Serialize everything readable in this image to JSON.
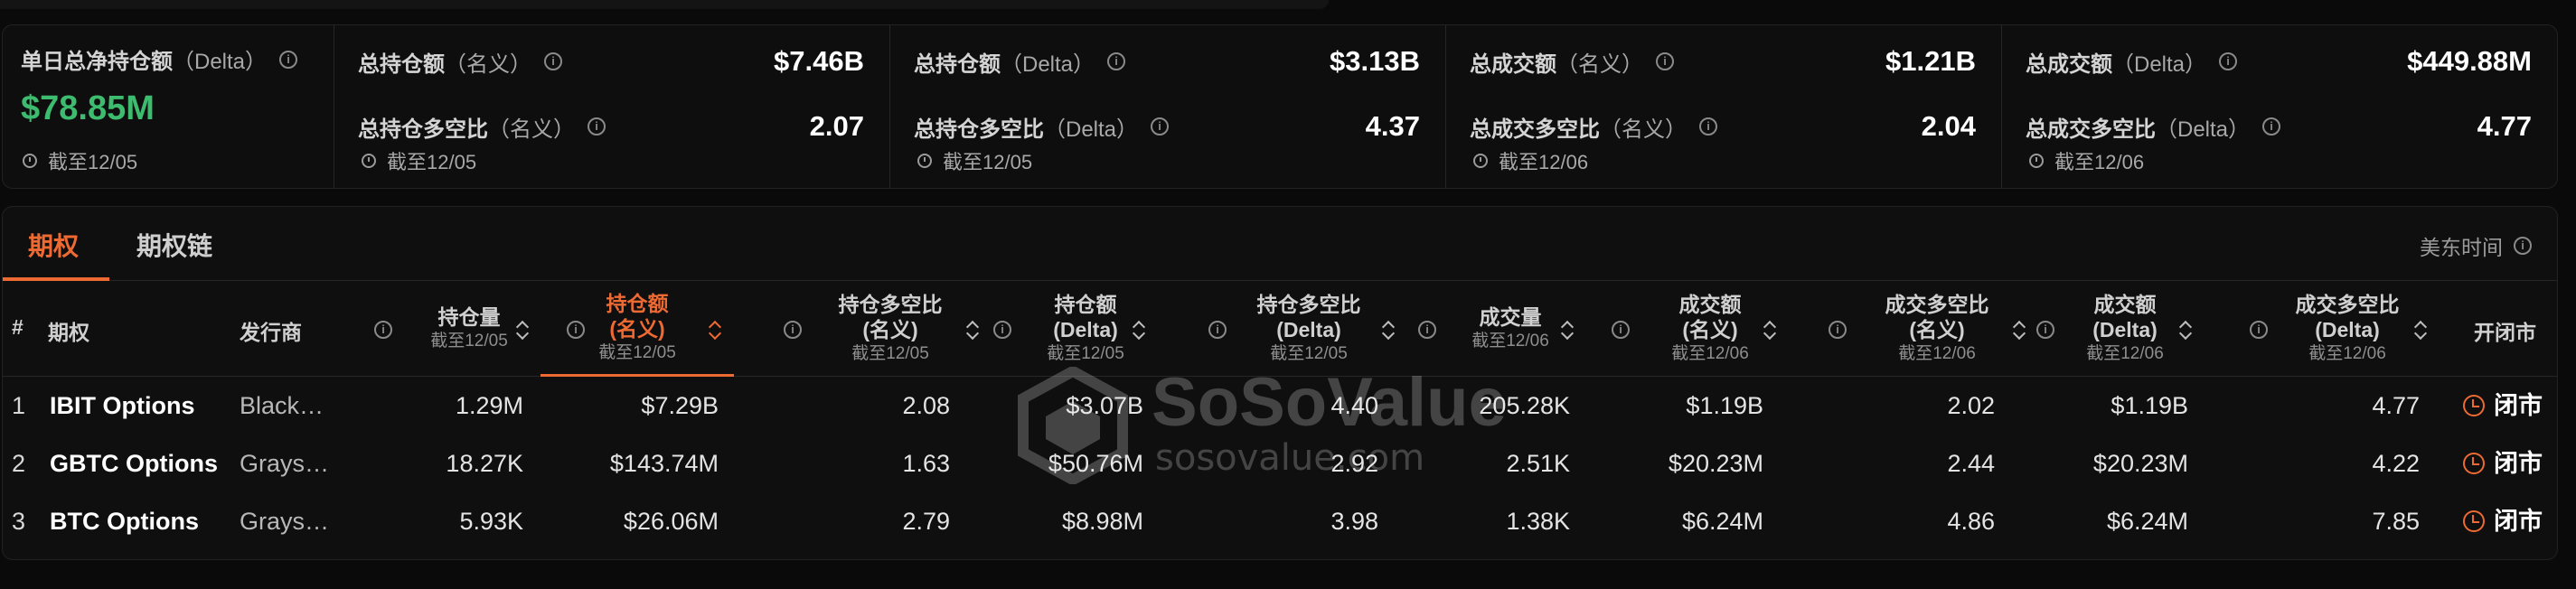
{
  "stats": {
    "daily": {
      "label": "单日总净持仓额",
      "label_paren": "（Delta）",
      "value": "$78.85M",
      "asof": "截至12/05"
    },
    "cards": [
      {
        "rows": [
          {
            "label": "总持仓额",
            "paren": "（名义）",
            "value": "$7.46B"
          },
          {
            "label": "总持仓多空比",
            "paren": "（名义）",
            "value": "2.07"
          }
        ],
        "asof": "截至12/05"
      },
      {
        "rows": [
          {
            "label": "总持仓额",
            "paren": "（Delta）",
            "value": "$3.13B"
          },
          {
            "label": "总持仓多空比",
            "paren": "（Delta）",
            "value": "4.37"
          }
        ],
        "asof": "截至12/05"
      },
      {
        "rows": [
          {
            "label": "总成交额",
            "paren": "（名义）",
            "value": "$1.21B"
          },
          {
            "label": "总成交多空比",
            "paren": "（名义）",
            "value": "2.04"
          }
        ],
        "asof": "截至12/06"
      },
      {
        "rows": [
          {
            "label": "总成交额",
            "paren": "（Delta）",
            "value": "$449.88M"
          },
          {
            "label": "总成交多空比",
            "paren": "（Delta）",
            "value": "4.77"
          }
        ],
        "asof": "截至12/06"
      }
    ],
    "value_color": "#3dbb6f"
  },
  "tabs": [
    {
      "label": "期权",
      "active": true
    },
    {
      "label": "期权链",
      "active": false
    }
  ],
  "timezone": "美东时间",
  "accent": "#ee6a33",
  "columns": {
    "idx": "#",
    "option": "期权",
    "issuer": "发行商",
    "oi_volume": {
      "title": "持仓量",
      "sub": "截至12/05"
    },
    "oi_notional": {
      "title": "持仓额",
      "title2": "(名义)",
      "sub": "截至12/05"
    },
    "oi_ratio_notional": {
      "title": "持仓多空比",
      "title2": "(名义)",
      "sub": "截至12/05"
    },
    "oi_delta": {
      "title": "持仓额",
      "title2": "(Delta)",
      "sub": "截至12/05"
    },
    "oi_ratio_delta": {
      "title": "持仓多空比",
      "title2": "(Delta)",
      "sub": "截至12/05"
    },
    "vol": {
      "title": "成交量",
      "sub": "截至12/06"
    },
    "vol_notional": {
      "title": "成交额",
      "title2": "(名义)",
      "sub": "截至12/06"
    },
    "vol_ratio_notional": {
      "title": "成交多空比",
      "title2": "(名义)",
      "sub": "截至12/06"
    },
    "vol_delta": {
      "title": "成交额",
      "title2": "(Delta)",
      "sub": "截至12/06"
    },
    "vol_ratio_delta": {
      "title": "成交多空比",
      "title2": "(Delta)",
      "sub": "截至12/06"
    },
    "market": "开闭市"
  },
  "rows": [
    {
      "idx": "1",
      "name": "IBIT Options",
      "issuer": "Black…",
      "oi_volume": "1.29M",
      "oi_notional": "$7.29B",
      "oi_ratio_notional": "2.08",
      "oi_delta": "$3.07B",
      "oi_ratio_delta": "4.40",
      "vol": "205.28K",
      "vol_notional": "$1.19B",
      "vol_ratio_notional": "2.02",
      "vol_delta": "$1.19B",
      "vol_ratio_delta": "4.77",
      "market": "闭市"
    },
    {
      "idx": "2",
      "name": "GBTC Options",
      "issuer": "Grays…",
      "oi_volume": "18.27K",
      "oi_notional": "$143.74M",
      "oi_ratio_notional": "1.63",
      "oi_delta": "$50.76M",
      "oi_ratio_delta": "2.92",
      "vol": "2.51K",
      "vol_notional": "$20.23M",
      "vol_ratio_notional": "2.44",
      "vol_delta": "$20.23M",
      "vol_ratio_delta": "4.22",
      "market": "闭市"
    },
    {
      "idx": "3",
      "name": "BTC Options",
      "issuer": "Grays…",
      "oi_volume": "5.93K",
      "oi_notional": "$26.06M",
      "oi_ratio_notional": "2.79",
      "oi_delta": "$8.98M",
      "oi_ratio_delta": "3.98",
      "vol": "1.38K",
      "vol_notional": "$6.24M",
      "vol_ratio_notional": "4.86",
      "vol_delta": "$6.24M",
      "vol_ratio_delta": "7.85",
      "market": "闭市"
    }
  ],
  "watermark": {
    "brand": "SoSoValue",
    "url": "sosovalue.com"
  }
}
